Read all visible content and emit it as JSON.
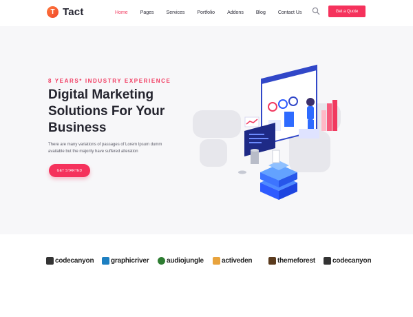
{
  "header": {
    "logo_letter": "T",
    "logo_text": "Tact",
    "nav": [
      {
        "label": "Home",
        "active": true
      },
      {
        "label": "Pages",
        "active": false
      },
      {
        "label": "Services",
        "active": false
      },
      {
        "label": "Portfolio",
        "active": false
      },
      {
        "label": "Addons",
        "active": false
      },
      {
        "label": "Blog",
        "active": false
      },
      {
        "label": "Contact Us",
        "active": false
      }
    ],
    "search_icon": "search-icon",
    "quote_label": "Get a Quote"
  },
  "hero": {
    "eyebrow": "8 YEARS* INDUSTRY EXPERIENCE",
    "headline_line1": "Digital Marketing",
    "headline_line2": "Solutions For Your",
    "headline_line3": "Business",
    "sub_line1": "There are many variations of passages of Lorem Ipsum dumm",
    "sub_line2": "available but the majority have suffered alteration",
    "cta_label": "GET STARTED"
  },
  "brands": [
    {
      "name": "codecanyon",
      "icon": "codecanyon-icon",
      "color": "#333333"
    },
    {
      "name": "graphicriver",
      "icon": "graphicriver-icon",
      "color": "#1d7fc1"
    },
    {
      "name": "audiojungle",
      "icon": "audiojungle-icon",
      "color": "#2e7d32"
    },
    {
      "name": "activeden",
      "icon": "activeden-icon",
      "color": "#e8a33d"
    },
    {
      "name": "themeforest",
      "icon": "themeforest-icon",
      "color": "#5b3b1e"
    },
    {
      "name": "codecanyon",
      "icon": "codecanyon-icon",
      "color": "#333333"
    }
  ],
  "colors": {
    "accent": "#f5325c",
    "dark_text": "#24242e",
    "hero_bg": "#f7f7f9"
  }
}
